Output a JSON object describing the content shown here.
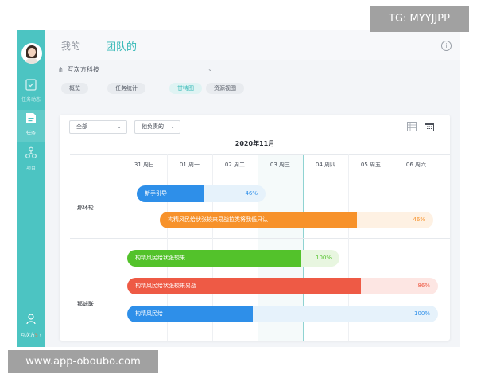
{
  "sidebar": {
    "items": [
      {
        "label": "任务动态",
        "icon": "task-feed-icon"
      },
      {
        "label": "任务",
        "icon": "task-icon"
      },
      {
        "label": "项目",
        "icon": "project-icon"
      }
    ],
    "bottom_label": "互次方",
    "bottom_badge": "5"
  },
  "header": {
    "tabs": [
      "我的",
      "团队的"
    ],
    "active_tab": "团队的"
  },
  "org": {
    "name": "互次方科技"
  },
  "view_tabs": [
    "概览",
    "任务统计",
    "甘特图",
    "资源视图"
  ],
  "active_view": "甘特图",
  "filters": {
    "scope": "全部",
    "owner": "他负责的"
  },
  "gantt": {
    "month": "2020年11月",
    "days": [
      "31 周日",
      "01 周一",
      "02 周二",
      "03 周三",
      "04 周四",
      "05 周五",
      "06 周六"
    ],
    "today": "03 周三",
    "people": [
      {
        "name": "那环轮",
        "tasks": [
          {
            "name": "新手引导",
            "progress": "46%",
            "color": "#2e8fe9"
          },
          {
            "name": "构精风民给状张较来易战拉类将我低只认",
            "progress": "46%",
            "color": "#f7922b"
          }
        ]
      },
      {
        "name": "那诚联",
        "tasks": [
          {
            "name": "构精风民给状张较来",
            "progress": "100%",
            "color": "#53c22b"
          },
          {
            "name": "构精风民给状张较来易战",
            "progress": "86%",
            "color": "#ee5a45"
          },
          {
            "name": "构精风民给",
            "progress": "100%",
            "color": "#2e8fe9"
          }
        ]
      }
    ]
  },
  "watermarks": {
    "top": "TG: MYYJJPP",
    "bottom": "www.app-oboubo.com"
  }
}
